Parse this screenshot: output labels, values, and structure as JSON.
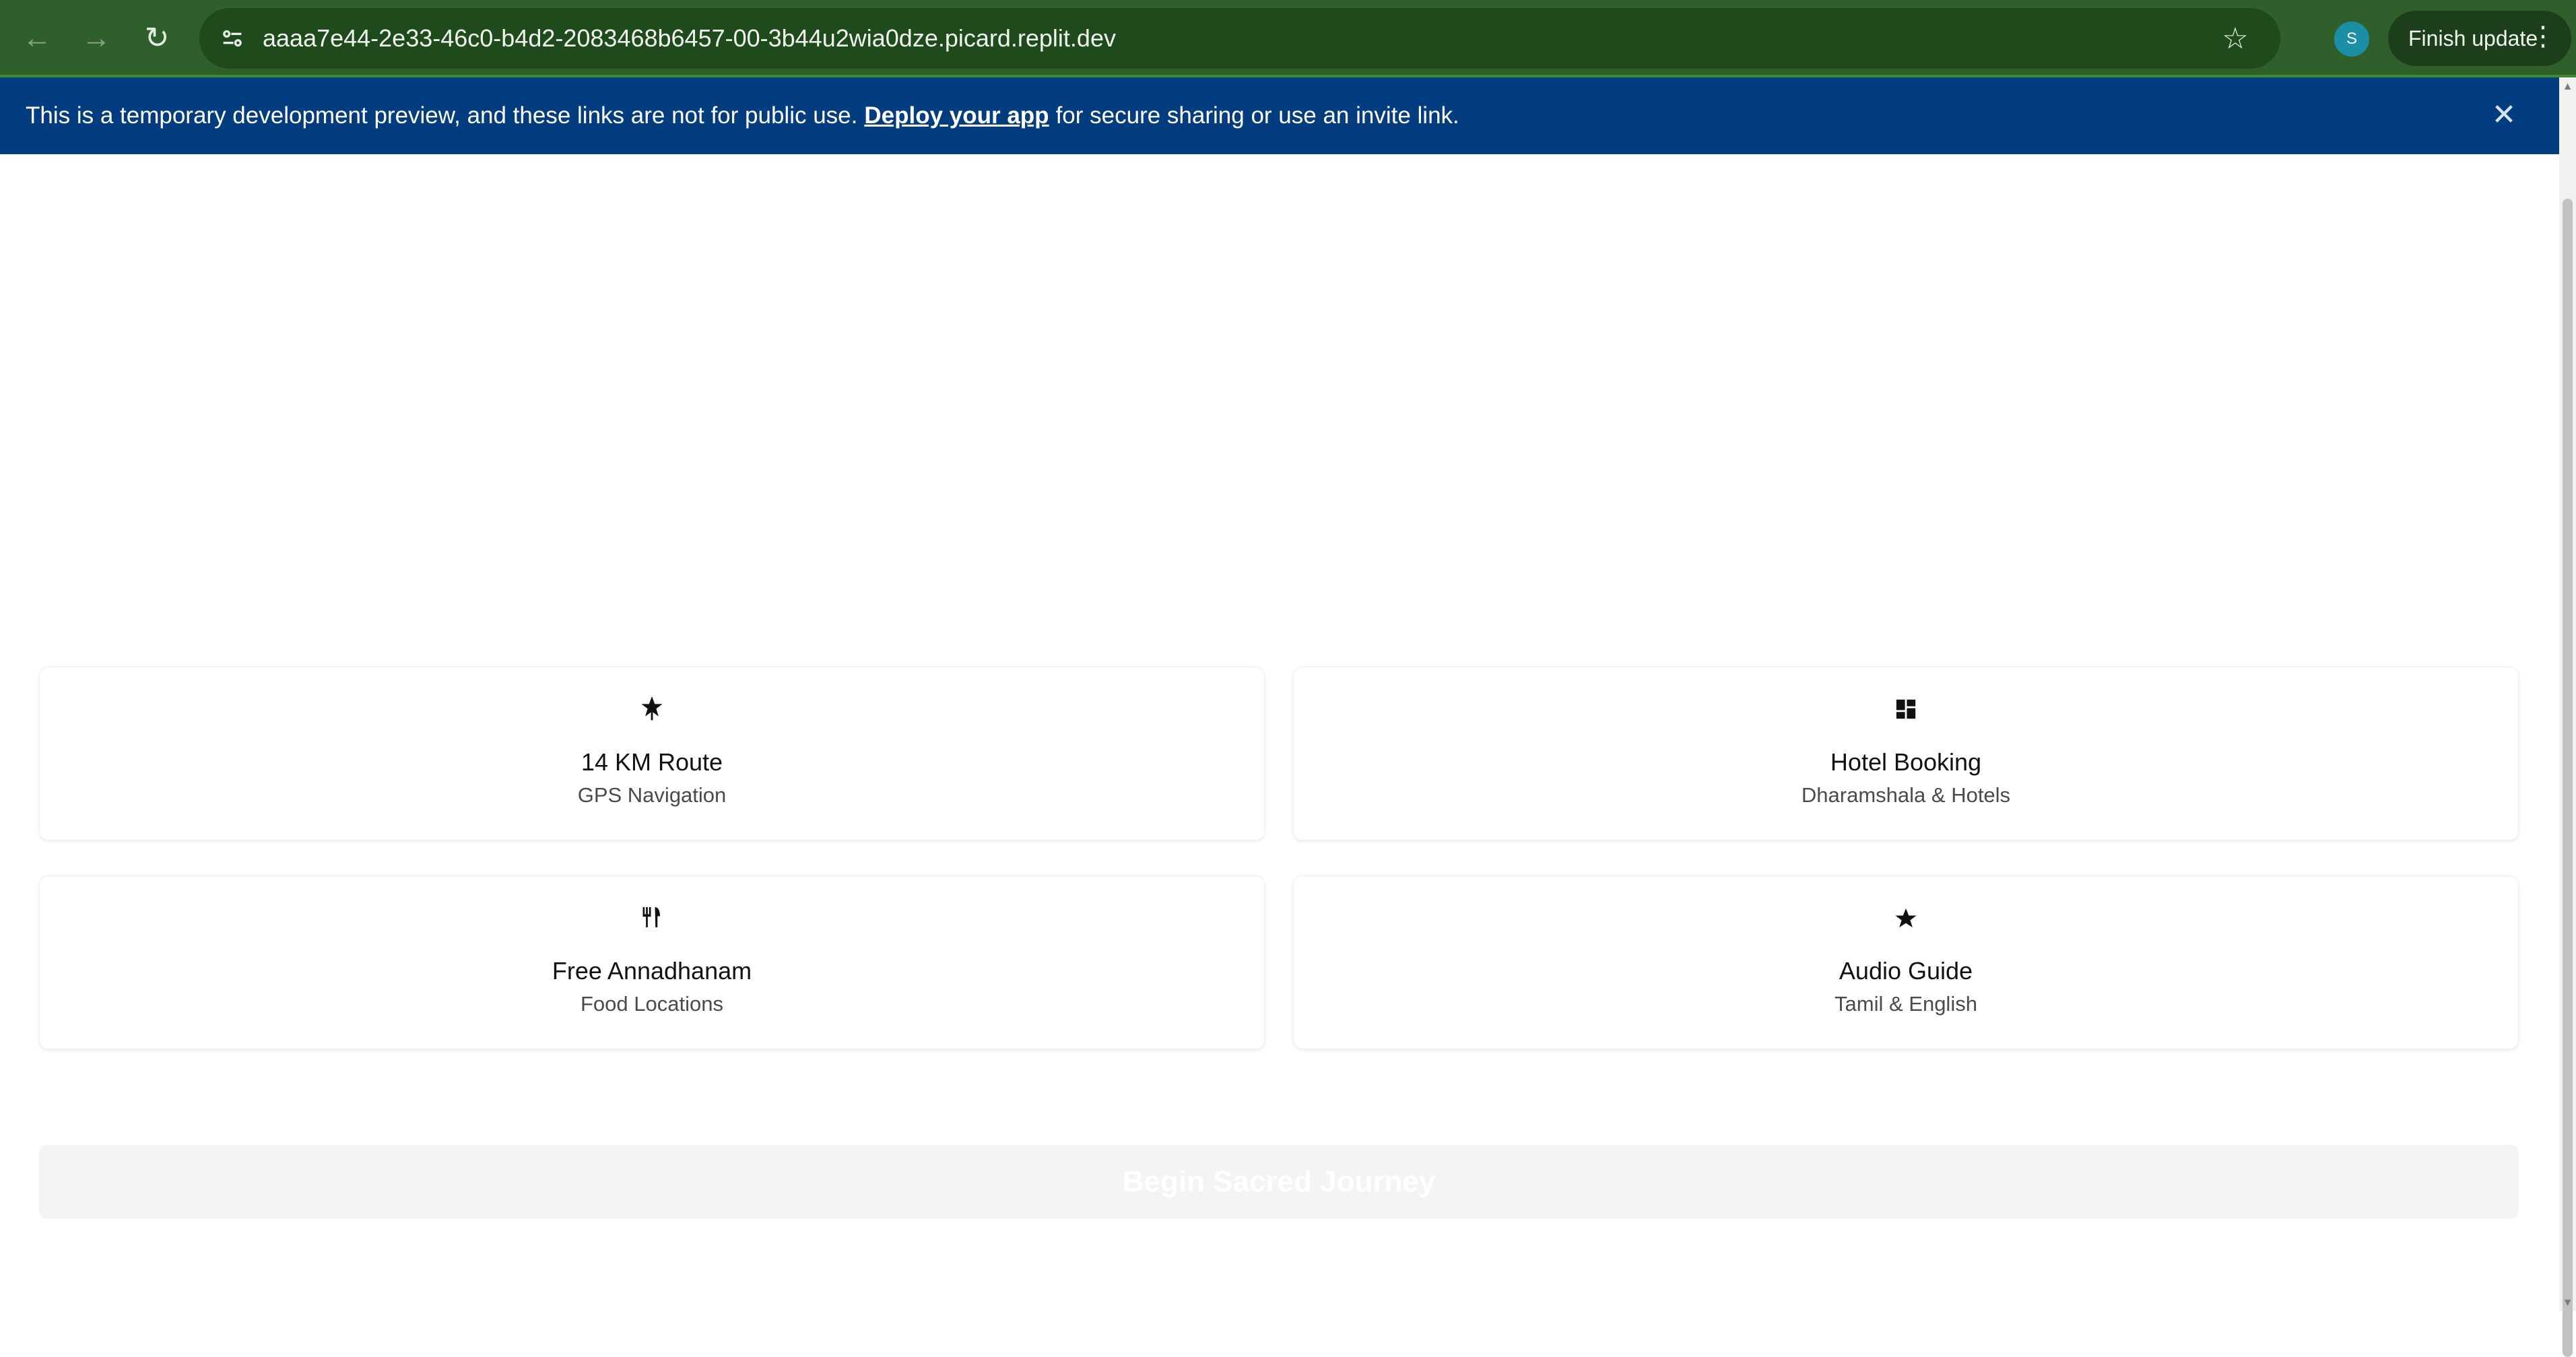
{
  "browser": {
    "url": "aaaa7e44-2e33-46c0-b4d2-2083468b6457-00-3b44u2wia0dze.picard.replit.dev",
    "profile_initial": "S",
    "finish_update_label": "Finish update",
    "icons": {
      "back": "arrow-left-icon",
      "forward": "arrow-right-icon",
      "reload": "reload-icon",
      "site_settings": "site-settings-icon",
      "bookmark": "star-outline-icon",
      "menu": "kebab-menu-icon"
    }
  },
  "banner": {
    "text_before": "This is a temporary development preview, and these links are not for public use.",
    "link_label": "Deploy your app",
    "text_after": "for secure sharing or use an invite link.",
    "background_color": "#033d80"
  },
  "features": [
    {
      "title": "14 KM Route",
      "subtitle": "GPS Navigation",
      "icon": "route-pin-icon"
    },
    {
      "title": "Hotel Booking",
      "subtitle": "Dharamshala & Hotels",
      "icon": "grid-icon"
    },
    {
      "title": "Free Annadhanam",
      "subtitle": "Food Locations",
      "icon": "utensils-icon"
    },
    {
      "title": "Audio Guide",
      "subtitle": "Tamil & English",
      "icon": "star-icon"
    }
  ],
  "cta": {
    "label": "Begin Sacred Journey",
    "state": "disabled"
  },
  "colors": {
    "chrome_bg": "#2f5f2a",
    "cta_bg": "#f3f4f6"
  }
}
